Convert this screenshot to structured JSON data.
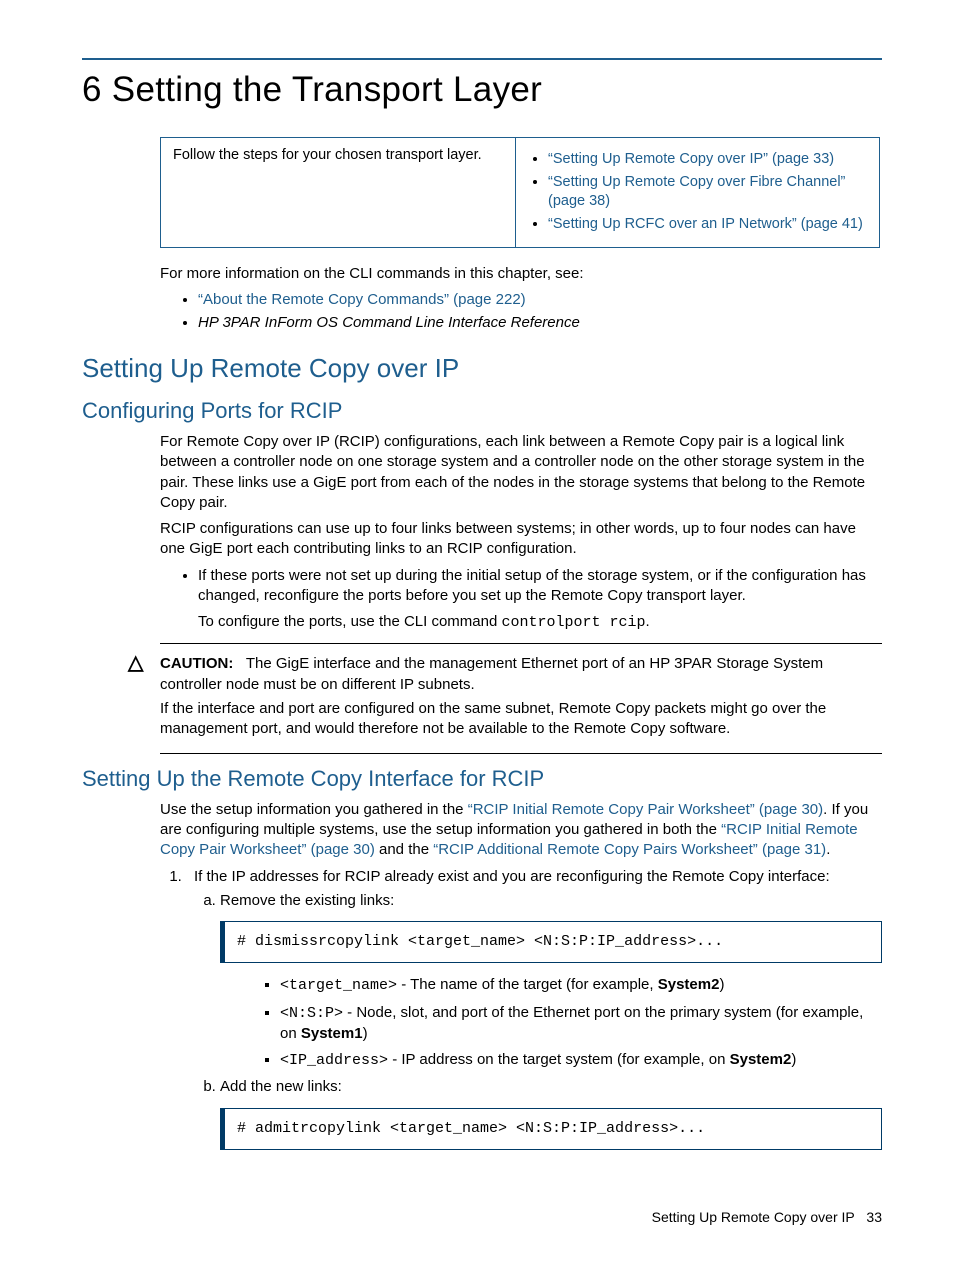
{
  "chapter": {
    "number": "6",
    "title": "Setting the Transport Layer"
  },
  "navTable": {
    "left": "Follow the steps for your chosen transport layer.",
    "links": [
      "“Setting Up Remote Copy over IP” (page 33)",
      "“Setting Up Remote Copy over Fibre Channel” (page 38)",
      "“Setting Up RCFC over an IP Network” (page 41)"
    ]
  },
  "introLine": "For more information on the CLI commands in this chapter, see:",
  "introBullets": {
    "link": "“About the Remote Copy Commands” (page 222)",
    "italic": "HP 3PAR InForm OS Command Line Interface Reference"
  },
  "sec1": {
    "title": "Setting Up Remote Copy over IP",
    "sub1": {
      "title": "Configuring Ports for RCIP",
      "p1": "For Remote Copy over IP (RCIP) configurations, each link between a Remote Copy pair is a logical link between a controller node on one storage system and a controller node on the other storage system in the pair. These links use a GigE port from each of the nodes in the storage systems that belong to the Remote Copy pair.",
      "p2": "RCIP configurations can use up to four links between systems; in other words, up to four nodes can have one GigE port each contributing links to an RCIP configuration.",
      "bullet": "If these ports were not set up during the initial setup of the storage system, or if the configuration has changed, reconfigure the ports before you set up the Remote Copy transport layer.",
      "bulletSubPre": "To configure the ports, use the CLI command ",
      "bulletSubCode": "controlport rcip",
      "bulletSubPost": "."
    },
    "caution": {
      "label": "CAUTION:",
      "p1a": "The GigE interface and the management Ethernet port of an HP 3PAR Storage System controller node must be on different IP subnets.",
      "p2": "If the interface and port are configured on the same subnet, Remote Copy packets might go over the management port, and would therefore not be available to the Remote Copy software."
    },
    "sub2": {
      "title": "Setting Up the Remote Copy Interface for RCIP",
      "p1a": "Use the setup information you gathered in the ",
      "p1link1": "“RCIP Initial Remote Copy Pair Worksheet” (page 30)",
      "p1b": ". If you are configuring multiple systems, use the setup information you gathered in both the ",
      "p1link2": "“RCIP Initial Remote Copy Pair Worksheet” (page 30)",
      "p1c": " and the ",
      "p1link3": "“RCIP Additional Remote Copy Pairs Worksheet” (page 31)",
      "p1d": ".",
      "step1": "If the IP addresses for RCIP already exist and you are reconfiguring the Remote Copy interface:",
      "step1a": "Remove the existing links:",
      "code1": "# dismissrcopylink <target_name> <N:S:P:IP_address>...",
      "params": [
        {
          "code": "<target_name>",
          "textPre": " - The name of the target (for example, ",
          "bold": "System2",
          "textPost": ")"
        },
        {
          "code": "<N:S:P>",
          "textPre": " - Node, slot, and port of the Ethernet port on the primary system (for example, on ",
          "bold": "System1",
          "textPost": ")"
        },
        {
          "code": "<IP_address>",
          "textPre": " - IP address on the target system (for example, on ",
          "bold": "System2",
          "textPost": ")"
        }
      ],
      "step1b": "Add the new links:",
      "code2": "# admitrcopylink <target_name> <N:S:P:IP_address>..."
    }
  },
  "footer": {
    "text": "Setting Up Remote Copy over IP",
    "page": "33"
  }
}
